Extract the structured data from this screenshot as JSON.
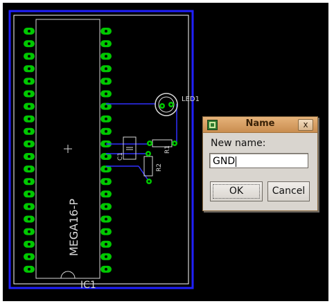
{
  "dialog": {
    "title": "Name",
    "close_label": "x",
    "field_label": "New name:",
    "field_value": "GND",
    "ok_label": "OK",
    "cancel_label": "Cancel"
  },
  "board": {
    "chip_label": "MEGA16-P",
    "chip_ref": "IC1",
    "led_ref": "LED1",
    "resistor1_ref": "R1",
    "resistor2_ref": "R2",
    "capacitor_ref": "C1"
  },
  "colors": {
    "background": "#000000",
    "board_outline": "#2020ff",
    "pad_green": "#00c800",
    "trace_blue": "#3030ff",
    "silkscreen": "#d9d9d9",
    "dialog_title": "#d69a5c"
  }
}
